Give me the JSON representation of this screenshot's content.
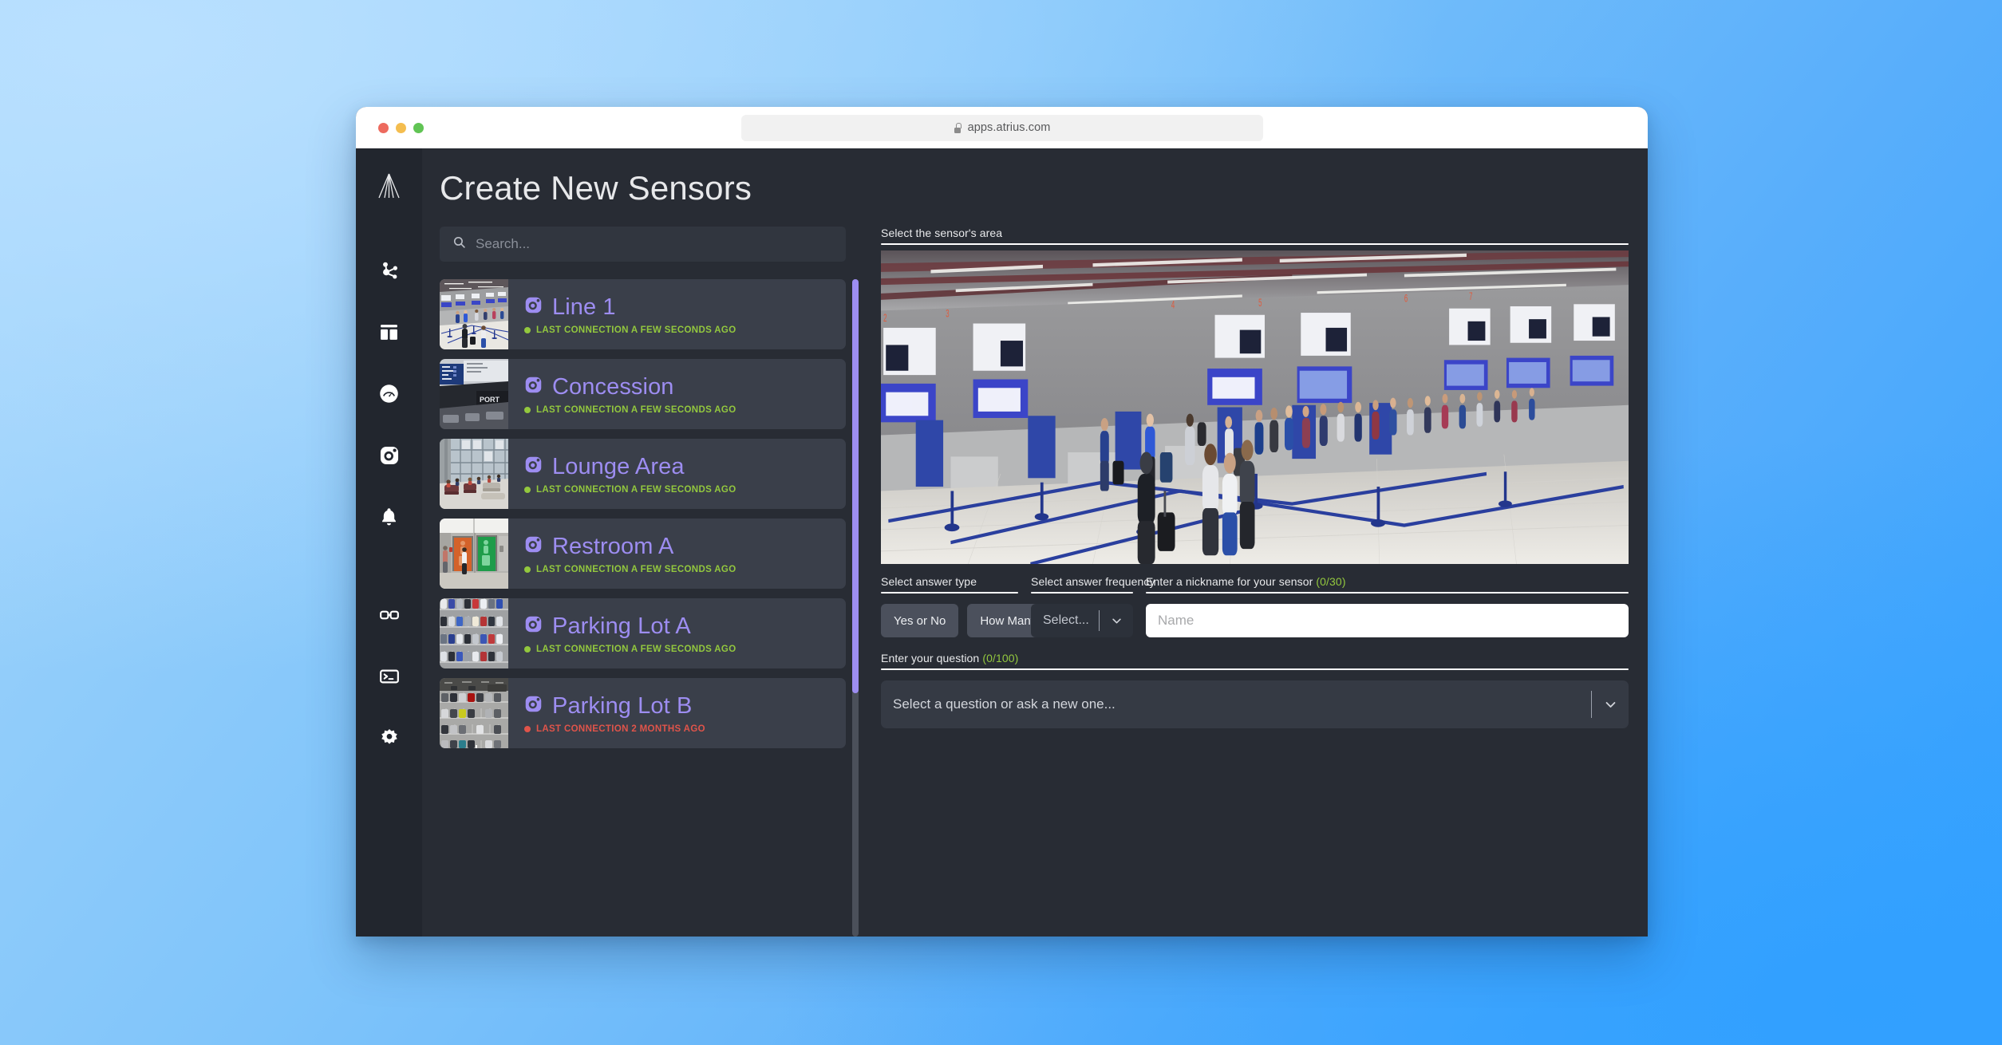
{
  "browser": {
    "url": "apps.atrius.com",
    "lock_icon": "lock-icon"
  },
  "header": {
    "title": "Create New Sensors",
    "logo_icon": "atrius-logo-icon"
  },
  "sidebar": {
    "items": [
      {
        "icon": "network-nodes-icon",
        "name": "sidebar-item-network"
      },
      {
        "icon": "dashboard-layout-icon",
        "name": "sidebar-item-dashboard"
      },
      {
        "icon": "gauge-icon",
        "name": "sidebar-item-performance"
      },
      {
        "icon": "camera-sensor-icon",
        "name": "sidebar-item-sensors"
      },
      {
        "icon": "bell-icon",
        "name": "sidebar-item-alerts"
      },
      {
        "icon": "link-icon",
        "name": "sidebar-item-integrations"
      },
      {
        "icon": "terminal-icon",
        "name": "sidebar-item-console"
      },
      {
        "icon": "gear-icon",
        "name": "sidebar-item-settings"
      }
    ]
  },
  "search": {
    "placeholder": "Search...",
    "value": "",
    "icon": "search-icon"
  },
  "sensor_list": {
    "scroll_thumb_percent": 63,
    "items": [
      {
        "title": "Line 1",
        "status": "LAST CONNECTION A FEW SECONDS AGO",
        "state": "online",
        "icon": "camera-sensor-icon",
        "thumb": "airport-checkin-queue"
      },
      {
        "title": "Concession",
        "status": "LAST CONNECTION A FEW SECONDS AGO",
        "state": "online",
        "icon": "camera-sensor-icon",
        "thumb": "airport-concession-signage"
      },
      {
        "title": "Lounge Area",
        "status": "LAST CONNECTION A FEW SECONDS AGO",
        "state": "online",
        "icon": "camera-sensor-icon",
        "thumb": "lounge-seating-windows"
      },
      {
        "title": "Restroom A",
        "status": "LAST CONNECTION A FEW SECONDS AGO",
        "state": "online",
        "icon": "camera-sensor-icon",
        "thumb": "restroom-doors-orange-green"
      },
      {
        "title": "Parking Lot A",
        "status": "LAST CONNECTION A FEW SECONDS AGO",
        "state": "online",
        "icon": "camera-sensor-icon",
        "thumb": "parking-lot-aerial-color"
      },
      {
        "title": "Parking Lot B",
        "status": "LAST CONNECTION 2 MONTHS AGO",
        "state": "offline",
        "icon": "camera-sensor-icon",
        "thumb": "parking-lot-aerial-gray"
      }
    ]
  },
  "detail": {
    "area": {
      "label": "Select the sensor's area",
      "image_alt": "airport-checkin-hall-with-queue"
    },
    "answer_type": {
      "label": "Select answer type",
      "options": [
        "Yes or No",
        "How Many"
      ]
    },
    "answer_frequency": {
      "label": "Select answer frequency",
      "value": "Select...",
      "chevron_icon": "chevron-down-icon"
    },
    "nickname": {
      "label": "Enter a nickname for your sensor",
      "counter": "(0/30)",
      "placeholder": "Name",
      "value": ""
    },
    "question": {
      "label": "Enter your question",
      "counter": "(0/100)",
      "value": "Select a question or ask a new one...",
      "chevron_icon": "chevron-down-icon"
    }
  },
  "colors": {
    "accent_purple": "#9d8df1",
    "status_online": "#93c83e",
    "status_offline": "#e0544a",
    "app_bg": "#282c34",
    "rail_bg": "#22262e",
    "card_bg": "#3a3f4a"
  }
}
